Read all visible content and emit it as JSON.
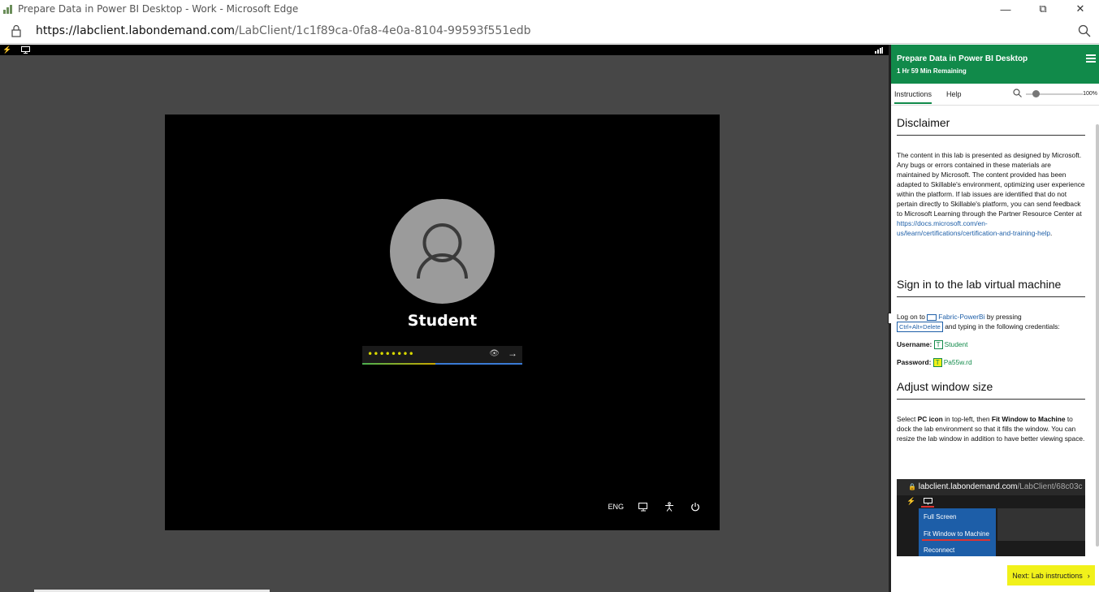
{
  "browser": {
    "window_title": "Prepare Data in Power BI Desktop - Work - Microsoft Edge",
    "url_host": "https://labclient.labondemand.com",
    "url_path": "/LabClient/1c1f89ca-0fa8-4e0a-8104-99593f551edb"
  },
  "vm": {
    "username": "Student",
    "password_mask": "••••••••",
    "tray_lang": "ENG",
    "icons": [
      "lightning-icon",
      "monitor-icon",
      "signal-icon",
      "eye-icon",
      "arrow-right-icon",
      "network-icon",
      "accessibility-icon",
      "power-icon"
    ]
  },
  "panel": {
    "title": "Prepare Data in Power BI Desktop",
    "time_remaining": "1 Hr 59 Min Remaining",
    "tabs": [
      "Instructions",
      "Help"
    ],
    "zoom": "100%",
    "disclaimer": {
      "heading": "Disclaimer",
      "body": "The content in this lab is presented as designed by Microsoft. Any bugs or errors contained in these materials are maintained by Microsoft. The content provided has been adapted to Skillable's environment, optimizing user experience within the platform. If lab issues are identified that do not pertain directly to Skillable's platform, you can send feedback to Microsoft Learning through the Partner Resource Center at",
      "link": "https://docs.microsoft.com/en-us/learn/certifications/certification-and-training-help",
      "end": "."
    },
    "signin": {
      "heading": "Sign in to the lab virtual machine",
      "log_on_to": "Log on to",
      "machine": "Fabric-PowerBi",
      "by_pressing": "by pressing",
      "keys": "Ctrl+Alt+Delete",
      "and_typing": "and typing in the following credentials:",
      "username_label": "Username:",
      "username_value": "Student",
      "password_label": "Password:",
      "password_value": "Pa55w.rd"
    },
    "adjust": {
      "heading": "Adjust window size",
      "p1": "Select",
      "b1": "PC icon",
      "p2": "in top-left, then",
      "b2": "Fit Window to Machine",
      "p3": "to dock the lab environment so that it fills the window. You can resize the lab window in addition to have better viewing space."
    },
    "screenshot": {
      "host": "labclient.labondemand.com",
      "path": "/LabClient/68c03c",
      "menu": [
        "Full Screen",
        "Fit Window to Machine",
        "Reconnect"
      ]
    },
    "next_button": "Next: Lab instructions"
  }
}
